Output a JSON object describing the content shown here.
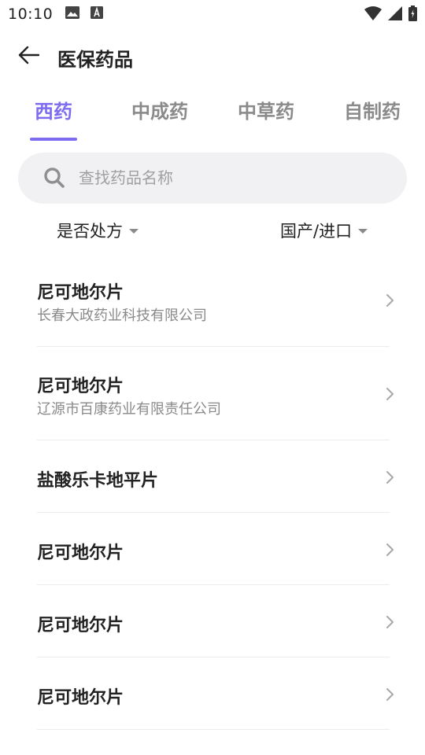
{
  "status_bar": {
    "time": "10:10",
    "left_icons": [
      "image-icon",
      "text-a-icon"
    ],
    "right_icons": [
      "wifi-icon",
      "signal-icon",
      "battery-icon"
    ]
  },
  "header": {
    "back_icon": "arrow-left-icon",
    "title": "医保药品"
  },
  "tabs": [
    {
      "label": "西药",
      "active": true
    },
    {
      "label": "中成药",
      "active": false
    },
    {
      "label": "中草药",
      "active": false
    },
    {
      "label": "自制药",
      "active": false
    }
  ],
  "search": {
    "placeholder": "查找药品名称",
    "value": ""
  },
  "filters": {
    "prescription": "是否处方",
    "origin": "国产/进口"
  },
  "drugs": [
    {
      "name": "尼可地尔片",
      "manufacturer": "长春大政药业科技有限公司"
    },
    {
      "name": "尼可地尔片",
      "manufacturer": "辽源市百康药业有限责任公司"
    },
    {
      "name": "盐酸乐卡地平片",
      "manufacturer": ""
    },
    {
      "name": "尼可地尔片",
      "manufacturer": ""
    },
    {
      "name": "尼可地尔片",
      "manufacturer": ""
    },
    {
      "name": "尼可地尔片",
      "manufacturer": ""
    }
  ],
  "colors": {
    "accent": "#7d6cf0",
    "inactive_tab": "#8a8a8a",
    "search_bg": "#f1f1f3",
    "divider": "#ececec"
  }
}
